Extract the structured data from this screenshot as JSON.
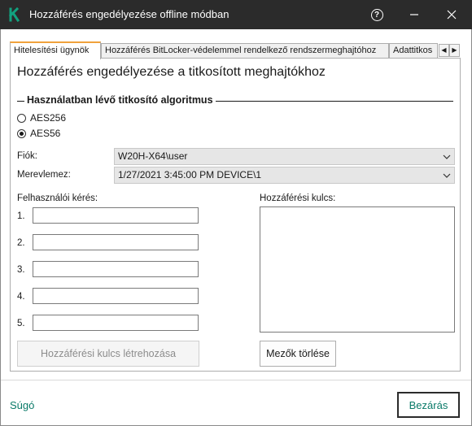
{
  "window": {
    "title": "Hozzáférés engedélyezése offline módban",
    "help_symbol": "?",
    "logo_icon": "kaspersky-k-logo",
    "accent_color": "#12a27f"
  },
  "tabs": [
    {
      "label": "Hitelesítési ügynök",
      "active": true
    },
    {
      "label": "Hozzáférés BitLocker-védelemmel rendelkező rendszermeghajtóhoz",
      "active": false
    },
    {
      "label": "Adattitkos",
      "active": false
    }
  ],
  "panel": {
    "heading": "Hozzáférés engedélyezése a titkosított meghajtókhoz",
    "algorithm_group": {
      "title": "Használatban lévő titkosító algoritmus",
      "options": [
        {
          "label": "AES256",
          "checked": false
        },
        {
          "label": "AES56",
          "checked": true
        }
      ]
    },
    "account_label": "Fiók:",
    "account_value": "W20H-X64\\user",
    "disk_label": "Merevlemez:",
    "disk_value": "1/27/2021 3:45:00 PM  DEVICE\\1",
    "user_request_label": "Felhasználói kérés:",
    "request_fields": [
      {
        "num": "1.",
        "value": ""
      },
      {
        "num": "2.",
        "value": ""
      },
      {
        "num": "3.",
        "value": ""
      },
      {
        "num": "4.",
        "value": ""
      },
      {
        "num": "5.",
        "value": ""
      }
    ],
    "access_key_label": "Hozzáférési kulcs:",
    "access_key_value": "",
    "generate_button": "Hozzáférési kulcs létrehozása",
    "clear_button": "Mezők törlése"
  },
  "footer": {
    "help_link": "Súgó",
    "close_button": "Bezárás"
  }
}
